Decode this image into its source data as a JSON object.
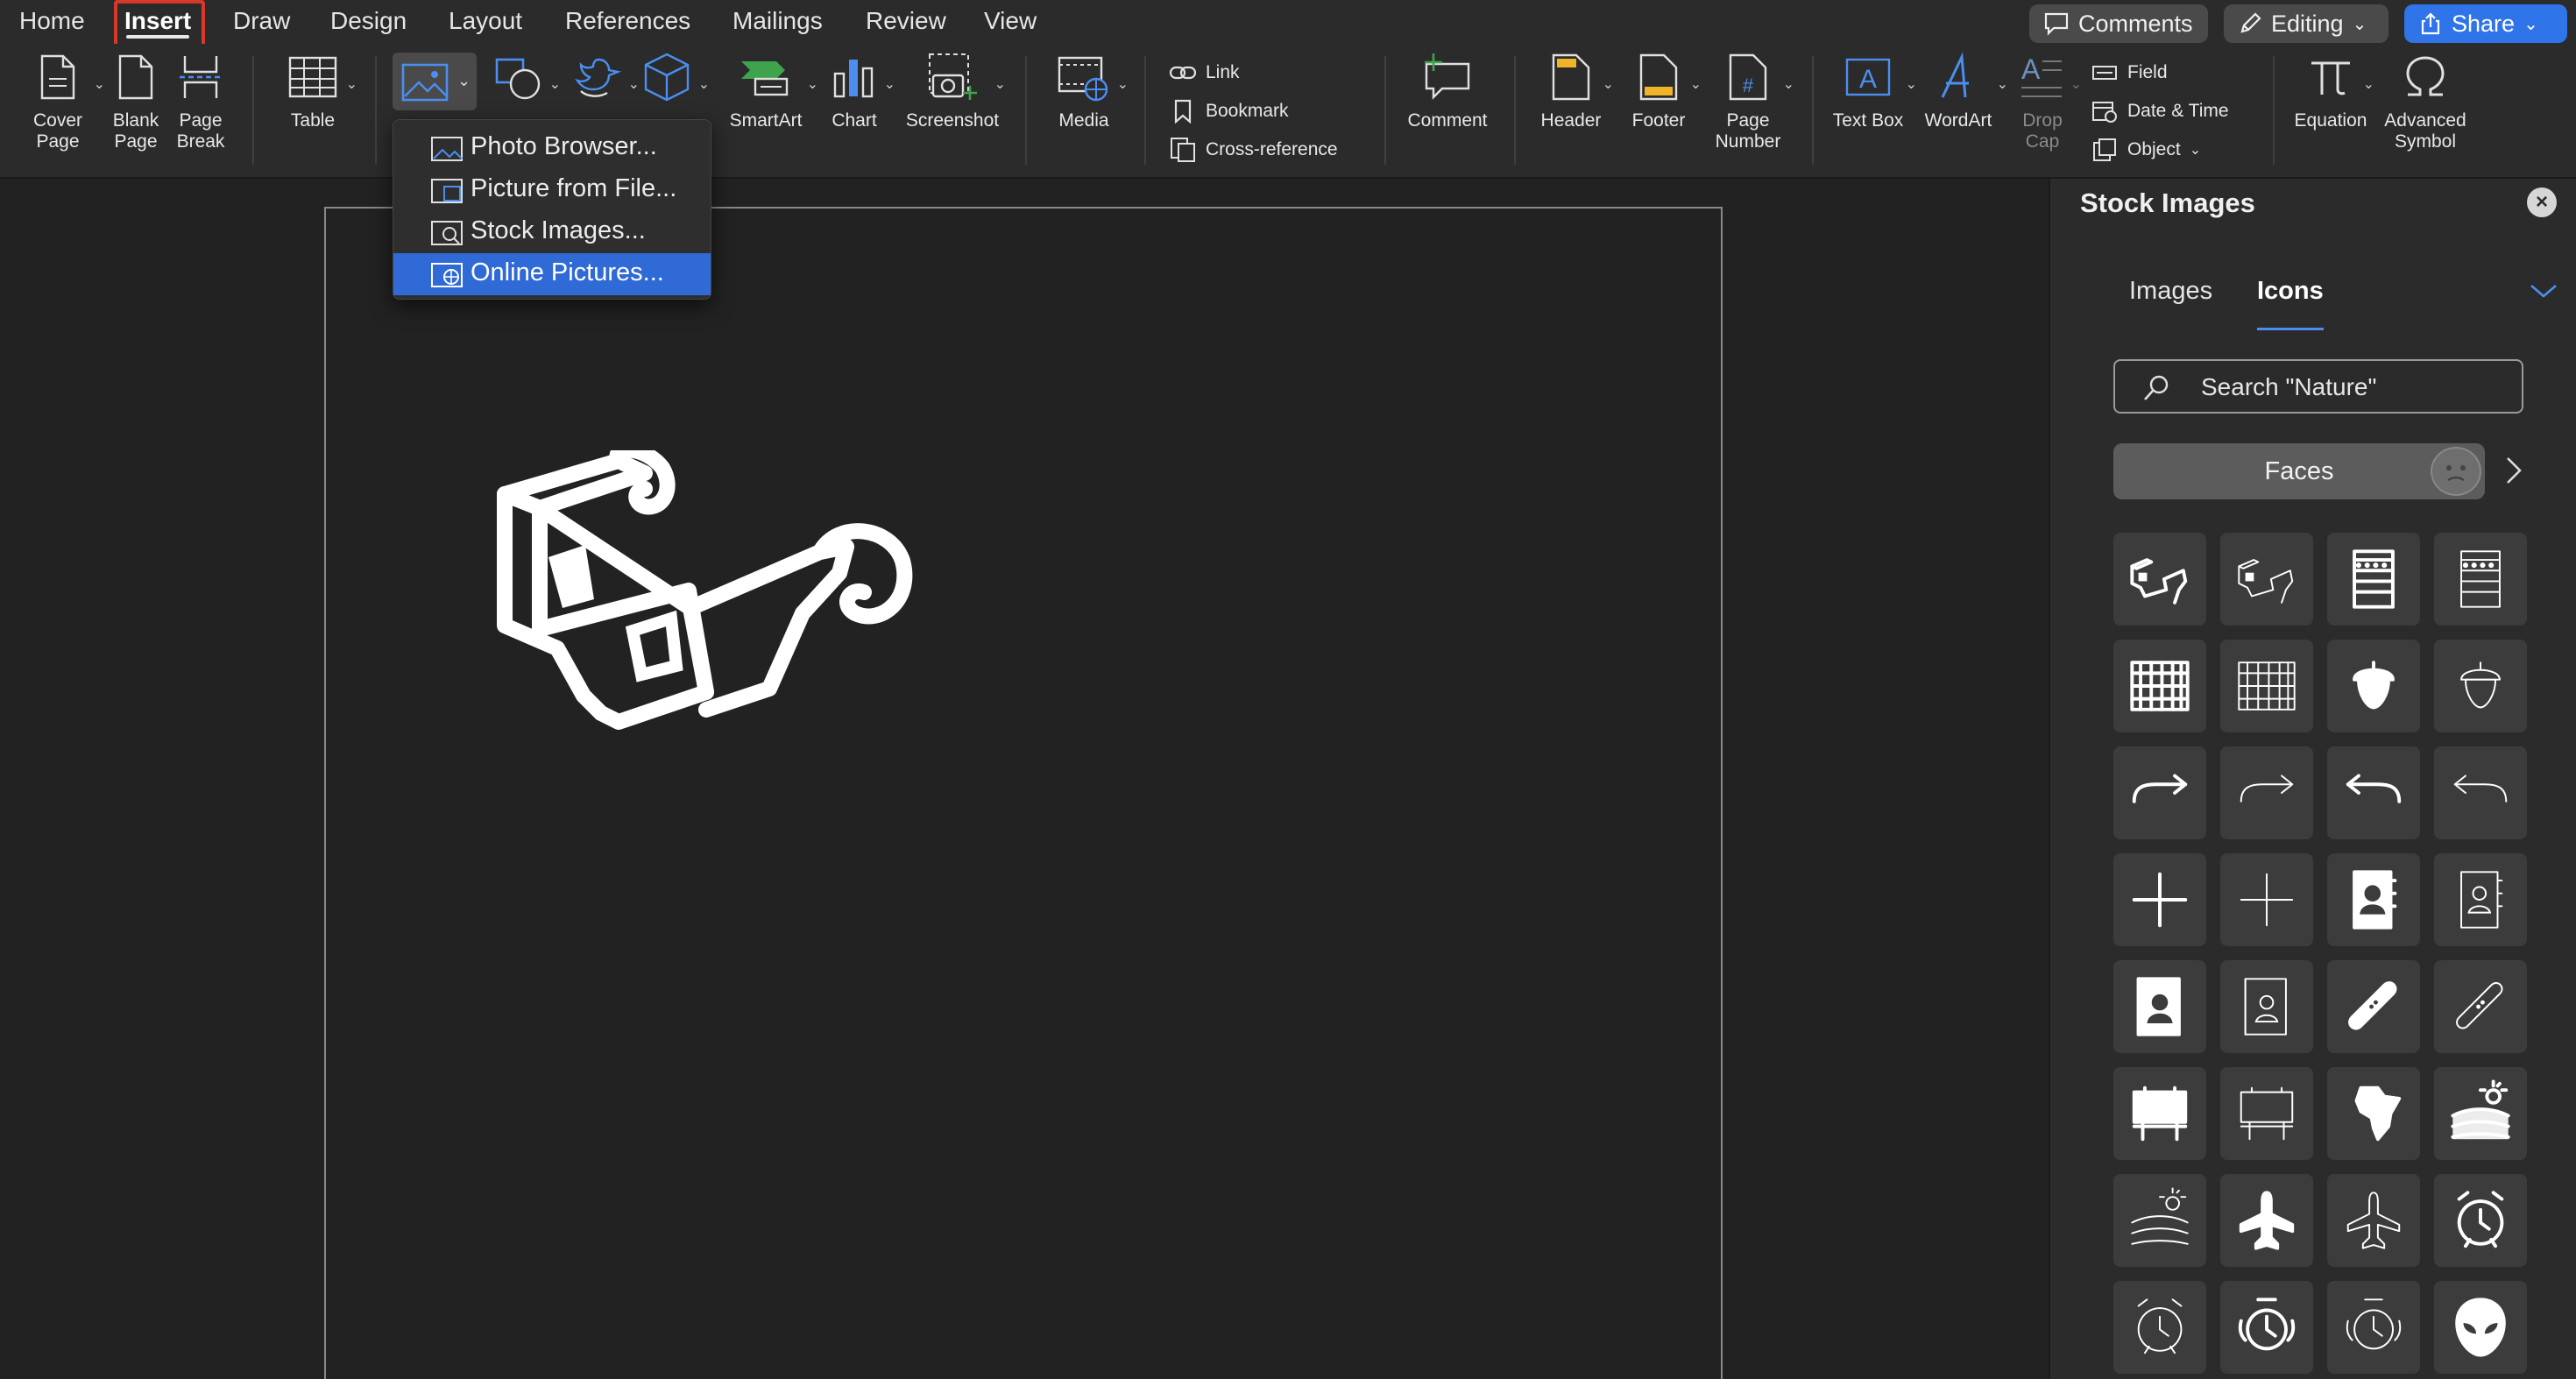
{
  "tabs": [
    "Home",
    "Insert",
    "Draw",
    "Design",
    "Layout",
    "References",
    "Mailings",
    "Review",
    "View"
  ],
  "active_tab": "Insert",
  "top_buttons": {
    "comments": "Comments",
    "editing": "Editing",
    "share": "Share"
  },
  "ribbon": {
    "cover_page": "Cover\nPage",
    "blank_page": "Blank\nPage",
    "page_break": "Page\nBreak",
    "table": "Table",
    "smartart": "SmartArt",
    "chart": "Chart",
    "screenshot": "Screenshot",
    "media": "Media",
    "link": "Link",
    "bookmark": "Bookmark",
    "cross_reference": "Cross-reference",
    "comment": "Comment",
    "header": "Header",
    "footer": "Footer",
    "page_number": "Page\nNumber",
    "text_box": "Text Box",
    "wordart": "WordArt",
    "drop_cap": "Drop\nCap",
    "field": "Field",
    "date_time": "Date & Time",
    "object": "Object",
    "equation": "Equation",
    "advanced_symbol": "Advanced\nSymbol"
  },
  "pictures_menu": {
    "items": [
      "Photo Browser...",
      "Picture from File...",
      "Stock Images...",
      "Online Pictures..."
    ],
    "selected": "Online Pictures..."
  },
  "stock_pane": {
    "title": "Stock Images",
    "tabs": [
      "Images",
      "Icons"
    ],
    "active_tab": "Icons",
    "search_placeholder": "Search \"Nature\"",
    "category": "Faces",
    "icons": [
      "3d-glasses-filled",
      "3d-glasses-outline",
      "abacus-filled",
      "abacus-outline",
      "abacus-frame-filled",
      "abacus-frame-outline",
      "acorn-filled",
      "acorn-outline",
      "arrow-turn-right-bold",
      "arrow-turn-right-thin",
      "arrow-turn-left-bold",
      "arrow-turn-left-thin",
      "plus-bold",
      "plus-thin",
      "address-book-filled",
      "address-book-outline",
      "contact-book-filled",
      "contact-book-outline",
      "bandage-filled",
      "bandage-outline",
      "billboard-filled",
      "billboard-outline",
      "africa-filled",
      "field-sun-filled",
      "field-sun-outline",
      "airplane-filled",
      "airplane-outline",
      "alarm-clock-filled",
      "alarm-clock-outline",
      "alarm-ringing-filled",
      "alarm-ringing-outline",
      "alien-face-filled"
    ]
  },
  "accent": "#2f6ad6"
}
